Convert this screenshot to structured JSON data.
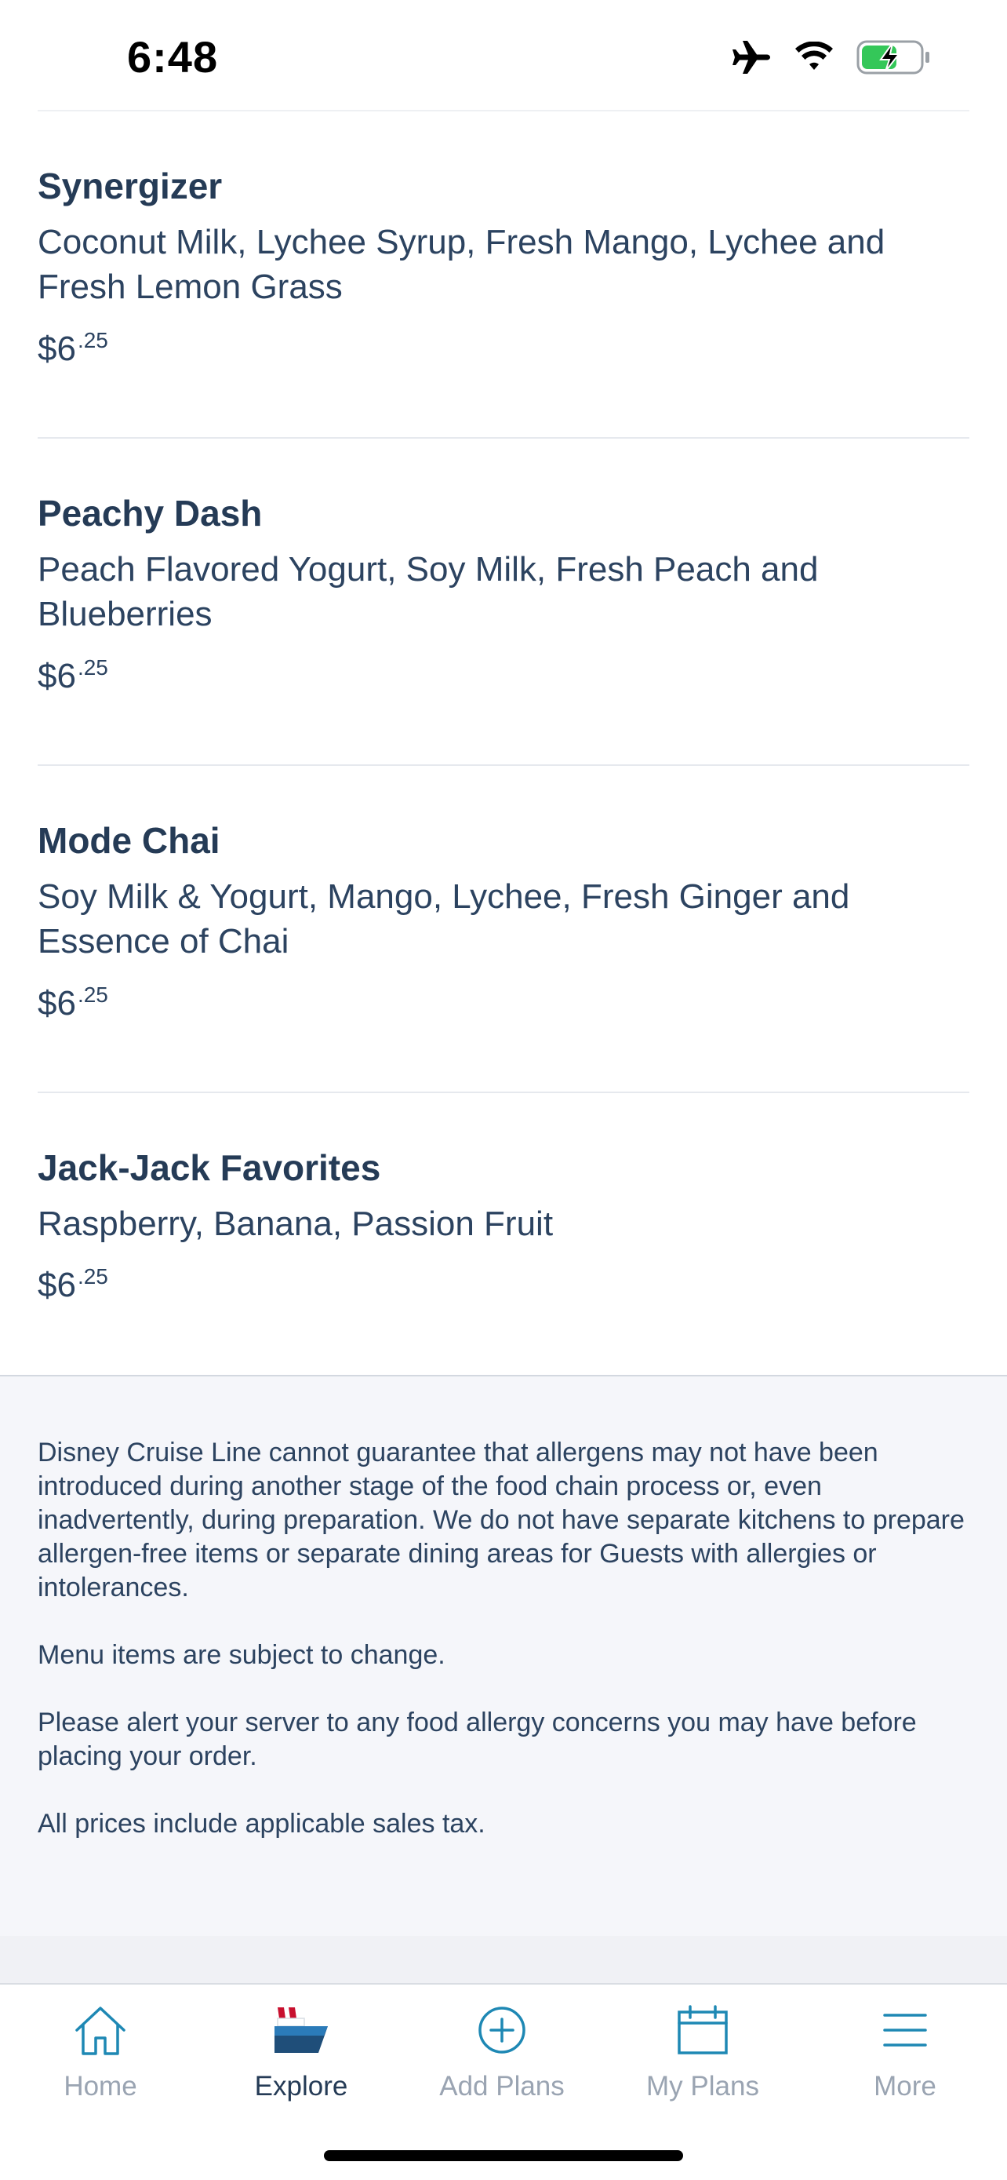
{
  "status_bar": {
    "time": "6:48",
    "icons": [
      "airplane-icon",
      "wifi-icon",
      "battery-charging-icon"
    ],
    "battery_color": "#34c759"
  },
  "menu": {
    "items": [
      {
        "name": "Synergizer",
        "description": "Coconut Milk, Lychee Syrup, Fresh Mango, Lychee and Fresh Lemon Grass",
        "price_dollars": "$6",
        "price_cents": ".25"
      },
      {
        "name": "Peachy Dash",
        "description": "Peach Flavored Yogurt, Soy Milk, Fresh Peach and Blueberries",
        "price_dollars": "$6",
        "price_cents": ".25"
      },
      {
        "name": "Mode Chai",
        "description": "Soy Milk & Yogurt, Mango, Lychee, Fresh Ginger and Essence of Chai",
        "price_dollars": "$6",
        "price_cents": ".25"
      },
      {
        "name": "Jack-Jack Favorites",
        "description": "Raspberry, Banana, Passion Fruit",
        "price_dollars": "$6",
        "price_cents": ".25"
      }
    ]
  },
  "disclaimer": {
    "allergen": "Disney Cruise Line cannot guarantee that allergens may not have been introduced during another stage of the food chain process or, even inadvertently, during preparation. We do not have separate kitchens to prepare allergen-free items or separate dining areas for Guests with allergies or intolerances.",
    "change": "Menu items are subject to change.",
    "alert": "Please alert your server to any food allergy concerns you may have before placing your order.",
    "tax": "All prices include applicable sales tax."
  },
  "tab_bar": {
    "active": "Explore",
    "tabs": [
      {
        "label": "Home",
        "icon": "home-icon"
      },
      {
        "label": "Explore",
        "icon": "ship-icon"
      },
      {
        "label": "Add Plans",
        "icon": "add-circle-icon"
      },
      {
        "label": "My Plans",
        "icon": "calendar-icon"
      },
      {
        "label": "More",
        "icon": "menu-icon"
      }
    ]
  },
  "colors": {
    "text_primary": "#253b56",
    "tab_inactive": "#9aa4b2",
    "tab_icon": "#1e88b4",
    "disclaimer_bg": "#f5f6fa"
  }
}
